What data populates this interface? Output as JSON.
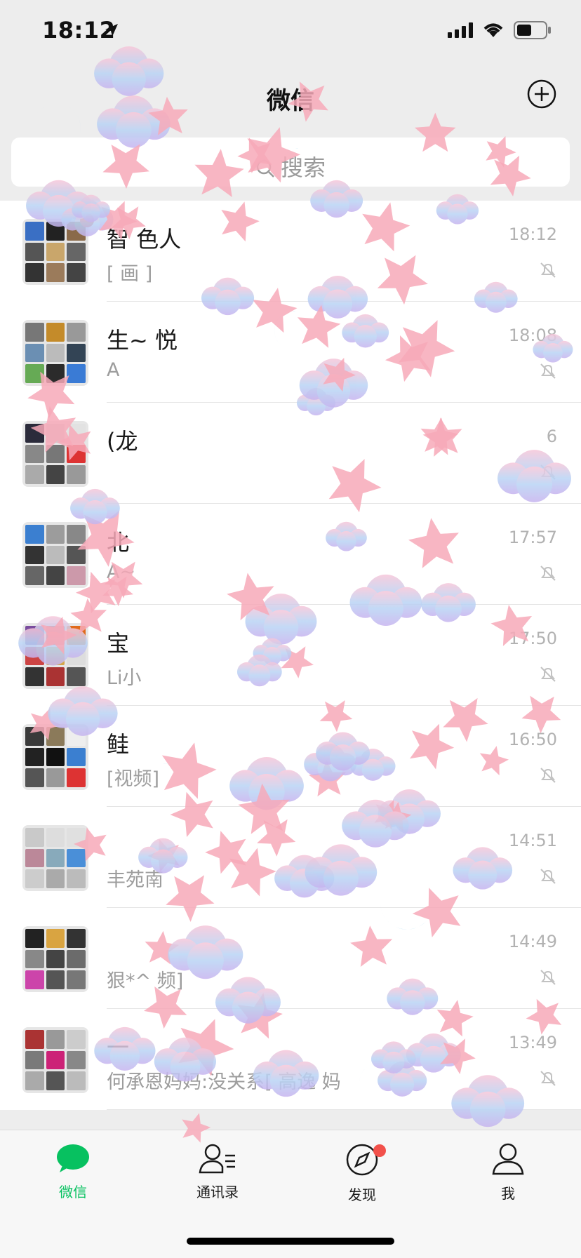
{
  "status_bar": {
    "time": "18:12"
  },
  "nav": {
    "title": "微信"
  },
  "search": {
    "placeholder": "搜索"
  },
  "chats": [
    {
      "name": "智    色人",
      "message": "[            画    ]",
      "time": "18:12",
      "unread_dot": true,
      "avatar_colors": [
        "#3a6fc4",
        "#222",
        "#8a6a4a",
        "#555",
        "#c9a66b",
        "#666",
        "#333",
        "#9b7b5b",
        "#444"
      ]
    },
    {
      "name": "生~    悦",
      "message": "A",
      "time": "18:08",
      "unread_dot": false,
      "avatar_colors": [
        "#777",
        "#c48b2a",
        "#999",
        "#6b8fb3",
        "#bbb",
        "#345",
        "#6a5",
        "#2b2b2b",
        "#3a7bd5"
      ]
    },
    {
      "name": "(龙",
      "message": "",
      "time": "6",
      "unread_dot": false,
      "avatar_colors": [
        "#2b2b3b",
        "#ccc",
        "#e2e2e2",
        "#888",
        "#777",
        "#d33",
        "#aaa",
        "#444",
        "#999"
      ]
    },
    {
      "name": "北",
      "message": "A~",
      "time": "17:57",
      "unread_dot": false,
      "avatar_colors": [
        "#3b7fd0",
        "#9c9c9c",
        "#888",
        "#333",
        "#bbb",
        "#555",
        "#666",
        "#444",
        "#c9a"
      ]
    },
    {
      "name": "宝",
      "message": "Li小",
      "time": "17:50",
      "unread_dot": false,
      "avatar_colors": [
        "#7a4d9e",
        "#9c2222",
        "#e06b1c",
        "#c44",
        "#d4a64a",
        "#ddd",
        "#333",
        "#a33",
        "#555"
      ]
    },
    {
      "name": "鲑",
      "message": "[视频]",
      "time": "16:50",
      "unread_dot": false,
      "avatar_colors": [
        "#3a3a3a",
        "#8b7a5a",
        "#eee",
        "#222",
        "#111",
        "#3b7fd0",
        "#555",
        "#999",
        "#d33"
      ]
    },
    {
      "name": "",
      "message": "丰苑南",
      "time": "14:51",
      "unread_dot": false,
      "avatar_colors": [
        "#c9c9c9",
        "#ddd",
        "#e0e0e0",
        "#b89",
        "#8ab",
        "#4a8fd8",
        "#ccc",
        "#aaa",
        "#bbb"
      ]
    },
    {
      "name": "",
      "message": "狠*^   频]",
      "time": "14:49",
      "unread_dot": false,
      "avatar_colors": [
        "#222",
        "#d9a441",
        "#333",
        "#888",
        "#444",
        "#6b6b6b",
        "#c4a",
        "#555",
        "#777"
      ]
    },
    {
      "name": "一",
      "message": "何承恩妈妈:没关系[    高逸    妈",
      "time": "13:49",
      "unread_dot": false,
      "avatar_colors": [
        "#a33",
        "#999",
        "#ccc",
        "#7a7a7a",
        "#c27",
        "#888",
        "#aaa",
        "#555",
        "#bbb"
      ]
    }
  ],
  "tabs": [
    {
      "label": "微信",
      "icon": "chat-bubble-icon",
      "active": true
    },
    {
      "label": "通讯录",
      "icon": "contacts-icon",
      "active": false
    },
    {
      "label": "发现",
      "icon": "compass-icon",
      "active": false,
      "dot": true
    },
    {
      "label": "我",
      "icon": "person-icon",
      "active": false
    }
  ],
  "colors": {
    "accent": "#07c160",
    "badge": "#f2514b"
  }
}
